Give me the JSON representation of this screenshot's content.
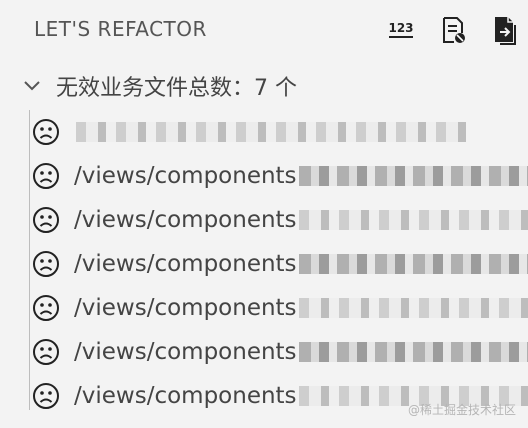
{
  "header": {
    "title": "LET'S REFACTOR",
    "actions": [
      {
        "name": "count-icon",
        "label": "123"
      },
      {
        "name": "file-ban-icon"
      },
      {
        "name": "export-file-icon"
      }
    ]
  },
  "section": {
    "label": "无效业务文件总数：7 个",
    "expanded": true
  },
  "files": [
    {
      "path": "",
      "icon": "sad-face-icon"
    },
    {
      "path": "/views/components",
      "icon": "sad-face-icon"
    },
    {
      "path": "/views/components",
      "icon": "sad-face-icon"
    },
    {
      "path": "/views/components",
      "icon": "sad-face-icon"
    },
    {
      "path": "/views/components",
      "icon": "sad-face-icon"
    },
    {
      "path": "/views/components",
      "icon": "sad-face-icon"
    },
    {
      "path": "/views/components",
      "icon": "sad-face-icon"
    }
  ],
  "watermark": "@稀土掘金技术社区"
}
